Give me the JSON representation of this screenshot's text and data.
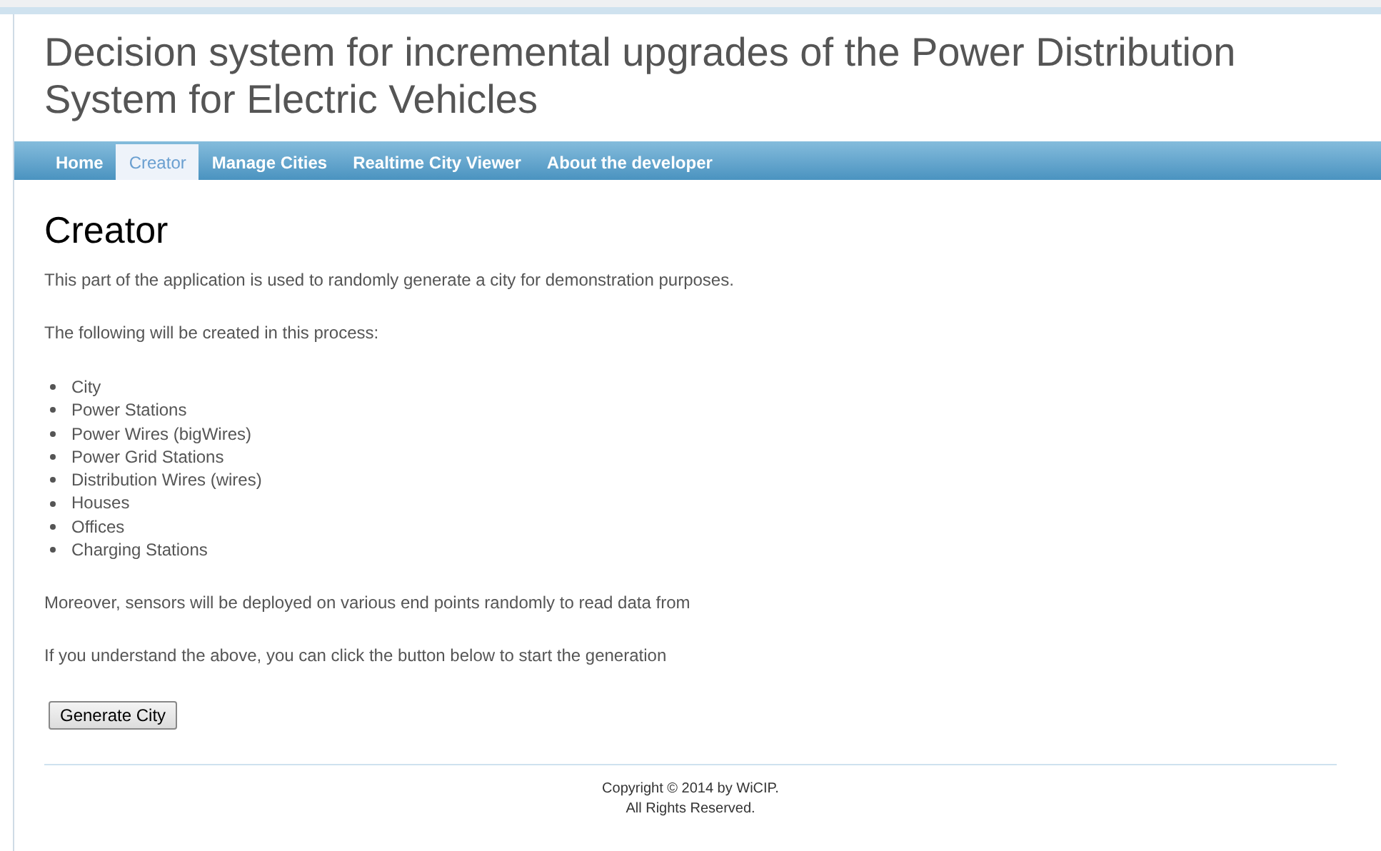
{
  "header": {
    "title": "Decision system for incremental upgrades of the Power Distribution System for Electric Vehicles"
  },
  "nav": [
    {
      "label": "Home",
      "selected": false
    },
    {
      "label": "Creator",
      "selected": true
    },
    {
      "label": "Manage Cities",
      "selected": false
    },
    {
      "label": "Realtime City Viewer",
      "selected": false
    },
    {
      "label": "About the developer",
      "selected": false
    }
  ],
  "content": {
    "heading": "Creator",
    "intro": "This part of the application is used to randomly generate a city for demonstration purposes.",
    "list_intro": "The following will be created in this process:",
    "items": [
      "City",
      "Power Stations",
      "Power Wires (bigWires)",
      "Power Grid Stations",
      "Distribution Wires (wires)",
      "Houses",
      "Offices",
      "Charging Stations"
    ],
    "paragraphs": [
      "Moreover, sensors will be deployed on various end points randomly to read data from",
      "If you understand the above, you can click the button below to start the generation"
    ],
    "button": "Generate City"
  },
  "footer": [
    "Copyright © 2014 by WiCIP.",
    "All Rights Reserved."
  ]
}
